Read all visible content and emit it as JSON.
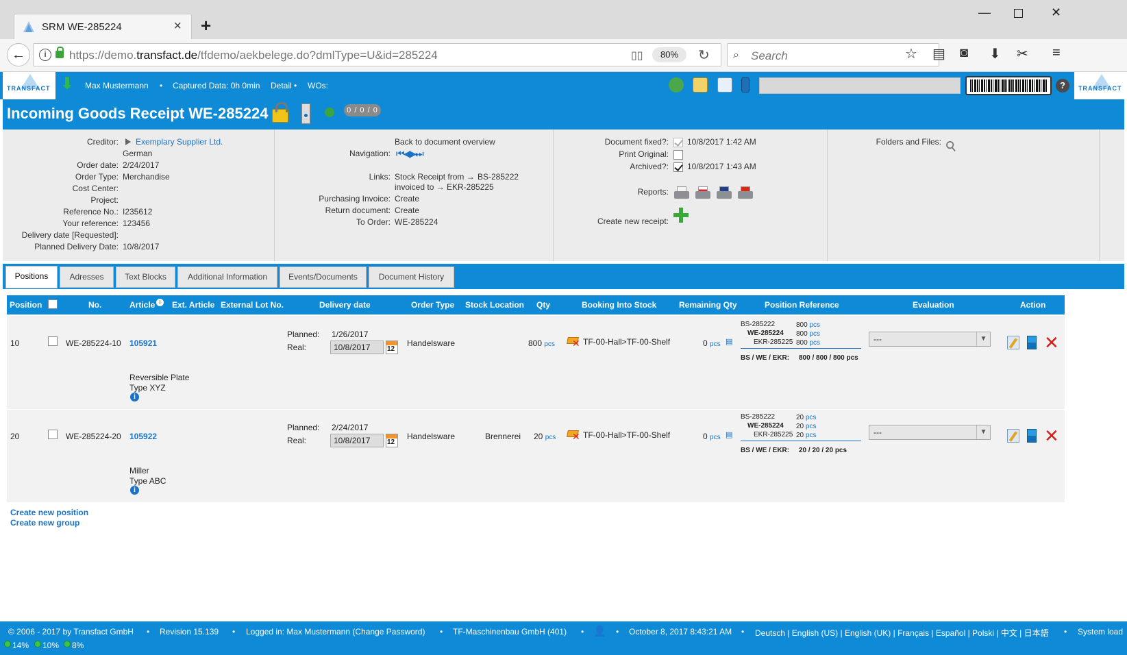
{
  "browser": {
    "tab_title": "SRM WE-285224",
    "new_tab": "+",
    "url_prefix": "https://demo.",
    "url_domain": "transfact.de",
    "url_path": "/tfdemo/aekbelege.do?dmlType=U&id=285224",
    "zoom": "80%",
    "search_placeholder": "Search"
  },
  "header": {
    "logo_text": "TRANSFACT",
    "user": "Max Mustermann",
    "bullet": "•",
    "captured": "Captured Data: 0h 0min",
    "detail": "Detail •",
    "wos": "WOs:",
    "help": "?"
  },
  "title": {
    "text": "Incoming Goods Receipt WE-285224",
    "counter": "0 / 0 / 0"
  },
  "left_fields": {
    "creditor_label": "Creditor:",
    "creditor_value": "Exemplary Supplier Ltd.",
    "language": "German",
    "order_date_label": "Order date:",
    "order_date": "2/24/2017",
    "order_type_label": "Order Type:",
    "order_type": "Merchandise",
    "cost_center_label": "Cost Center:",
    "project_label": "Project:",
    "reference_label": "Reference No.:",
    "reference": "I235612",
    "your_ref_label": "Your reference:",
    "your_ref": "123456",
    "delivery_req_label": "Delivery date [Requested]:",
    "planned_label": "Planned Delivery Date:",
    "planned": "10/8/2017"
  },
  "mid_fields": {
    "back_link": "Back to document overview",
    "navigation_label": "Navigation:",
    "links_label": "Links:",
    "stock_receipt": "Stock Receipt from →",
    "stock_receipt_link": "BS-285222",
    "invoiced": "invoiced to →",
    "invoiced_link": "EKR-285225",
    "purchasing_label": "Purchasing Invoice:",
    "purchasing_link": "Create",
    "return_label": "Return document:",
    "return_link": "Create",
    "to_order_label": "To Order:",
    "to_order_link": "WE-285224"
  },
  "right_fields": {
    "fixed_label": "Document fixed?:",
    "fixed_value": "10/8/2017 1:42 AM",
    "print_label": "Print Original:",
    "archived_label": "Archived?:",
    "archived_value": "10/8/2017 1:43 AM",
    "reports_label": "Reports:",
    "new_receipt_label": "Create new receipt:",
    "folders_label": "Folders and Files:"
  },
  "tabs": [
    "Positions",
    "Adresses",
    "Text Blocks",
    "Additional Information",
    "Events/Documents",
    "Document History"
  ],
  "columns": {
    "position": "Position",
    "no": "No.",
    "article": "Article",
    "ext_article": "Ext. Article",
    "ext_lot": "External Lot No.",
    "delivery": "Delivery date",
    "order_type": "Order Type",
    "stock_location": "Stock Location",
    "qty": "Qty",
    "booking": "Booking Into Stock",
    "remaining": "Remaining Qty",
    "pos_ref": "Position Reference",
    "evaluation": "Evaluation",
    "action": "Action"
  },
  "rows": [
    {
      "pos": "10",
      "no": "WE-285224-10",
      "article": "105921",
      "desc1": "Reversible Plate",
      "desc2": "Type XYZ",
      "planned_label": "Planned:",
      "planned": "1/26/2017",
      "real_label": "Real:",
      "real": "10/8/2017",
      "cal": "12",
      "order_type": "Handelsware",
      "stock_location": "",
      "qty": "800",
      "unit": "pcs",
      "booking": "TF-00-Hall>TF-00-Shelf",
      "remaining": "0",
      "ref_bs": "BS-285222",
      "ref_bs_q": "800",
      "ref_we": "WE-285224",
      "ref_we_q": "800",
      "ref_ekr": "EKR-285225",
      "ref_ekr_q": "800",
      "summary_label": "BS / WE / EKR:",
      "summary": "800 / 800 / 800 pcs",
      "evaluation": "---"
    },
    {
      "pos": "20",
      "no": "WE-285224-20",
      "article": "105922",
      "desc1": "Miller",
      "desc2": "Type ABC",
      "planned_label": "Planned:",
      "planned": "2/24/2017",
      "real_label": "Real:",
      "real": "10/8/2017",
      "cal": "12",
      "order_type": "Handelsware",
      "stock_location": "Brennerei",
      "qty": "20",
      "unit": "pcs",
      "booking": "TF-00-Hall>TF-00-Shelf",
      "remaining": "0",
      "ref_bs": "BS-285222",
      "ref_bs_q": "20",
      "ref_we": "WE-285224",
      "ref_we_q": "20",
      "ref_ekr": "EKR-285225",
      "ref_ekr_q": "20",
      "summary_label": "BS / WE / EKR:",
      "summary": "20 / 20 / 20 pcs",
      "evaluation": "---"
    }
  ],
  "bottom_links": {
    "new_position": "Create new position",
    "new_group": "Create new group"
  },
  "footer": {
    "copyright": "© 2006 - 2017 by Transfact GmbH",
    "revision": "Revision  15.139",
    "logged_in": "Logged in: Max Mustermann (Change Password)",
    "company": "TF-Maschinenbau GmbH (401)",
    "datetime": "October 8, 2017 8:43:21 AM",
    "languages": "Deutsch | English (US) | English (UK) | Français | Español | Polski | 中文 | 日本語",
    "system_load": "System load",
    "load1": "14%",
    "load2": "10%",
    "load3": "8%"
  }
}
